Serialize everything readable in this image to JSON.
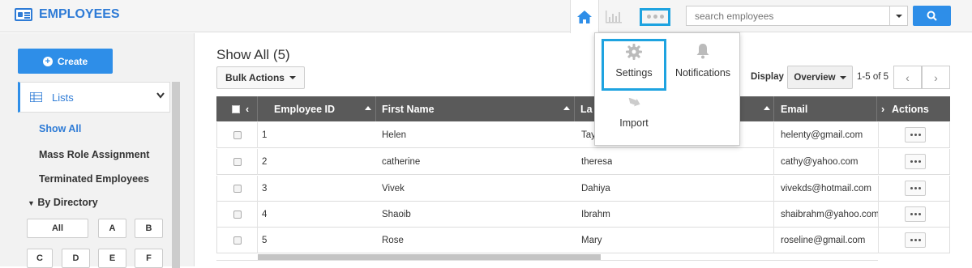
{
  "app": {
    "title": "EMPLOYEES"
  },
  "search": {
    "placeholder": "search employees"
  },
  "sidebar": {
    "create_label": "Create",
    "lists_label": "Lists",
    "items": [
      {
        "label": "Show All",
        "active": true
      },
      {
        "label": "Mass Role Assignment",
        "active": false
      },
      {
        "label": "Terminated Employees",
        "active": false
      }
    ],
    "directory_label": "By Directory",
    "letters": [
      "All",
      "A",
      "B",
      "C",
      "D",
      "E",
      "F"
    ]
  },
  "main": {
    "title": "Show All (5)",
    "bulk_actions_label": "Bulk Actions",
    "display_label": "Display",
    "display_value": "Overview",
    "pager_text": "1-5 of 5"
  },
  "table": {
    "columns": [
      "Employee ID",
      "First Name",
      "La",
      "Email",
      "Actions"
    ],
    "rows": [
      {
        "id": "1",
        "first": "Helen",
        "last": "Tay",
        "email": "helenty@gmail.com"
      },
      {
        "id": "2",
        "first": "catherine",
        "last": "theresa",
        "email": "cathy@yahoo.com"
      },
      {
        "id": "3",
        "first": "Vivek",
        "last": "Dahiya",
        "email": "vivekds@hotmail.com"
      },
      {
        "id": "4",
        "first": "Shaoib",
        "last": "Ibrahm",
        "email": "shaibrahm@yahoo.com"
      },
      {
        "id": "5",
        "first": "Rose",
        "last": "Mary",
        "email": "roseline@gmail.com"
      }
    ]
  },
  "popup": {
    "settings_label": "Settings",
    "notifications_label": "Notifications",
    "import_label": "Import"
  },
  "colors": {
    "accent": "#2e8ee8",
    "highlight": "#1ea3e0",
    "header_bg": "#5a5a5a"
  }
}
